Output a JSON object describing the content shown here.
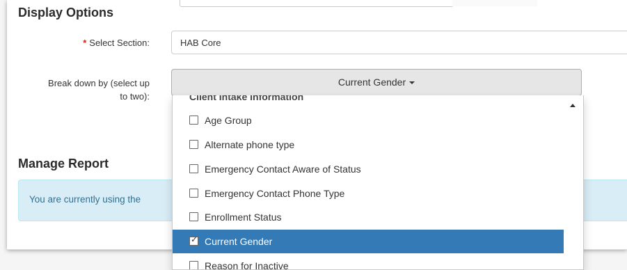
{
  "display_options": {
    "title": "Display Options",
    "select_section": {
      "required_mark": "*",
      "label": "Select Section:",
      "value": "HAB Core"
    },
    "breakdown": {
      "label_line1": "Break down by (select up",
      "label_line2": "to two):",
      "button_label": "Current Gender"
    }
  },
  "dropdown": {
    "group_header": "Client Intake Information",
    "options": [
      {
        "label": "Age Group",
        "checked": false
      },
      {
        "label": "Alternate phone type",
        "checked": false
      },
      {
        "label": "Emergency Contact Aware of Status",
        "checked": false
      },
      {
        "label": "Emergency Contact Phone Type",
        "checked": false
      },
      {
        "label": "Enrollment Status",
        "checked": false
      },
      {
        "label": "Current Gender",
        "checked": true
      },
      {
        "label": "Reason for Inactive",
        "checked": false
      }
    ]
  },
  "manage_report": {
    "title": "Manage Report",
    "info_text": "You are currently using the",
    "info_tail": "."
  },
  "colors": {
    "selected_bg": "#337ab7",
    "info_bg": "#d9edf7",
    "required": "#d9230f"
  }
}
